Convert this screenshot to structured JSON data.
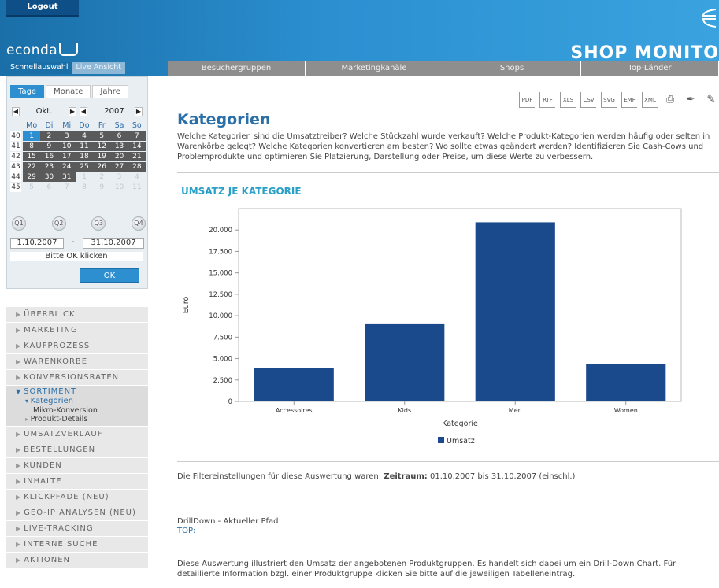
{
  "header": {
    "logout_label": "Logout",
    "logo_text": "econda",
    "brand_text": "SHOP MONITO",
    "colors": {
      "header_blue": "#2b8fd0",
      "accent_blue": "#2a6fa8",
      "nav_gray": "#8e8e8e",
      "bar_blue": "#1a4a8c"
    }
  },
  "left_tabs": [
    {
      "label": "Schnellauswahl"
    },
    {
      "label": "Live Ansicht"
    }
  ],
  "top_nav": [
    {
      "label": "Besuchergruppen"
    },
    {
      "label": "Marketingkanäle"
    },
    {
      "label": "Shops"
    },
    {
      "label": "Top-Länder"
    }
  ],
  "period_tabs": [
    {
      "label": "Tage"
    },
    {
      "label": "Monate"
    },
    {
      "label": "Jahre"
    }
  ],
  "calendar": {
    "month": "Okt.",
    "year": "2007",
    "prev_icon": "chevron-left-icon",
    "next_icon": "chevron-right-icon",
    "weekday_headers": [
      "Mo",
      "Di",
      "Mi",
      "Do",
      "Fr",
      "Sa",
      "So"
    ],
    "weeks": [
      {
        "wk": "40",
        "days": [
          [
            "1",
            "sel"
          ],
          [
            "2",
            "in"
          ],
          [
            "3",
            "in"
          ],
          [
            "4",
            "in"
          ],
          [
            "5",
            "in"
          ],
          [
            "6",
            "in"
          ],
          [
            "7",
            "in"
          ]
        ]
      },
      {
        "wk": "41",
        "days": [
          [
            "8",
            "in"
          ],
          [
            "9",
            "in"
          ],
          [
            "10",
            "in"
          ],
          [
            "11",
            "in"
          ],
          [
            "12",
            "in"
          ],
          [
            "13",
            "in"
          ],
          [
            "14",
            "in"
          ]
        ]
      },
      {
        "wk": "42",
        "days": [
          [
            "15",
            "in"
          ],
          [
            "16",
            "in"
          ],
          [
            "17",
            "in"
          ],
          [
            "18",
            "in"
          ],
          [
            "19",
            "in"
          ],
          [
            "20",
            "in"
          ],
          [
            "21",
            "in"
          ]
        ]
      },
      {
        "wk": "43",
        "days": [
          [
            "22",
            "in"
          ],
          [
            "23",
            "in"
          ],
          [
            "24",
            "in"
          ],
          [
            "25",
            "in"
          ],
          [
            "26",
            "in"
          ],
          [
            "27",
            "in"
          ],
          [
            "28",
            "in"
          ]
        ]
      },
      {
        "wk": "44",
        "days": [
          [
            "29",
            "in"
          ],
          [
            "30",
            "in"
          ],
          [
            "31",
            "in"
          ],
          [
            "1",
            "out"
          ],
          [
            "2",
            "out"
          ],
          [
            "3",
            "out"
          ],
          [
            "4",
            "out"
          ]
        ]
      },
      {
        "wk": "45",
        "days": [
          [
            "5",
            "out"
          ],
          [
            "6",
            "out"
          ],
          [
            "7",
            "out"
          ],
          [
            "8",
            "out"
          ],
          [
            "9",
            "out"
          ],
          [
            "10",
            "out"
          ],
          [
            "11",
            "out"
          ]
        ]
      }
    ],
    "quarters": [
      "Q1",
      "Q2",
      "Q3",
      "Q4"
    ],
    "date_from": "1.10.2007",
    "date_sep": "-",
    "date_to": "31.10.2007",
    "hint": "Bitte OK klicken",
    "ok_label": "OK"
  },
  "menu": {
    "items_before": [
      "ÜBERBLICK",
      "MARKETING",
      "KAUFPROZESS",
      "WARENKÖRBE",
      "KONVERSIONSRATEN"
    ],
    "open_item": "SORTIMENT",
    "open_sub": "Kategorien",
    "open_sub2": "Mikro-Konversion",
    "open_sub3": "Produkt-Details",
    "items_after": [
      "UMSATZVERLAUF",
      "BESTELLUNGEN",
      "KUNDEN",
      "INHALTE",
      "KLICKPFADE (NEU)",
      "GEO-IP ANALYSEN (NEU)",
      "LIVE-TRACKING",
      "INTERNE SUCHE",
      "AKTIONEN"
    ]
  },
  "toolbar": [
    {
      "label": "PDF",
      "icon": "export-pdf-icon"
    },
    {
      "label": "RTF",
      "icon": "export-rtf-icon"
    },
    {
      "label": "XLS",
      "icon": "export-xls-icon"
    },
    {
      "label": "CSV",
      "icon": "export-csv-icon"
    },
    {
      "label": "SVG",
      "icon": "export-svg-icon"
    },
    {
      "label": "EMF",
      "icon": "export-emf-icon"
    },
    {
      "label": "XML",
      "icon": "export-xml-icon"
    },
    {
      "label": "",
      "icon": "printer-icon"
    },
    {
      "label": "",
      "icon": "pen-icon"
    },
    {
      "label": "",
      "icon": "pencil-icon"
    }
  ],
  "main": {
    "title": "Kategorien",
    "intro": "Welche Kategorien sind die Umsatztreiber? Welche Stückzahl wurde verkauft? Welche Produkt-Kategorien werden häufig oder selten in Warenkörbe gelegt? Welche Kategorien konvertieren am besten? Wo sollte etwas geändert werden? Identifizieren Sie Cash-Cows und Problemprodukte und optimieren Sie Platzierung, Darstellung oder Preise, um diese Werte zu verbessern.",
    "chart_heading": "UMSATZ JE KATEGORIE",
    "filter_prefix": "Die Filtereinstellungen für diese Auswertung waren: ",
    "filter_label": "Zeitraum:",
    "filter_value": " 01.10.2007 bis 31.10.2007 (einschl.)",
    "drill_title": "DrillDown - Aktueller Pfad",
    "drill_top": "TOP:",
    "footer": "Diese Auswertung illustriert den Umsatz der angebotenen Produktgruppen. Es handelt sich dabei um ein Drill-Down Chart. Für detaillierte Information bzgl. einer Produktgruppe klicken Sie bitte auf die jeweiligen Tabelleneintrag."
  },
  "chart_data": {
    "type": "bar",
    "title": "",
    "xlabel": "Kategorie",
    "ylabel": "Euro",
    "categories": [
      "Accessoires",
      "Kids",
      "Men",
      "Women"
    ],
    "series": [
      {
        "name": "Umsatz",
        "values": [
          3900,
          9100,
          20900,
          4400
        ],
        "color": "#1a4a8c"
      }
    ],
    "yticks": [
      "0",
      "2.500",
      "5.000",
      "7.500",
      "10.000",
      "12.500",
      "15.000",
      "17.500",
      "20.000"
    ],
    "ylim": [
      0,
      22500
    ],
    "grid": false,
    "legend": "bottom"
  }
}
